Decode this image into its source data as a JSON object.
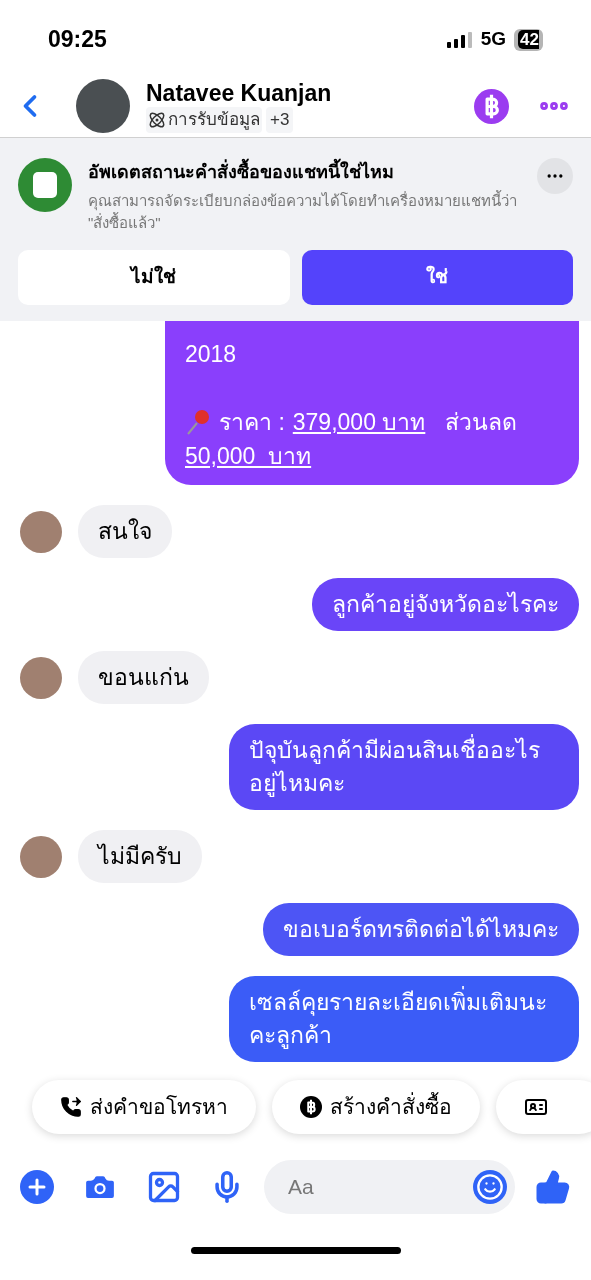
{
  "status_bar": {
    "time": "09:25",
    "network": "5G",
    "battery": "42"
  },
  "header": {
    "name": "Natavee Kuanjan",
    "tag": "การรับข้อมูล",
    "more_tags": "+3"
  },
  "banner": {
    "title": "อัพเดตสถานะคำสั่งซื้อของแชทนี้ใช่ไหม",
    "body": "คุณสามารถจัดระเบียบกล่องข้อความได้โดยทำเครื่องหมายแชทนี้ว่า \"สั่งซื้อแล้ว\"",
    "buttons": [
      {
        "label": "ไม่ใช่",
        "selected": false
      },
      {
        "label": "ใช่",
        "selected": true
      }
    ]
  },
  "messages": [
    {
      "kind": "sent_price",
      "year": "2018",
      "price_label": "ราคา :",
      "price": "379,000 บาท",
      "discount_label": "ส่วนลด",
      "discount": "50,000  บาท"
    },
    {
      "kind": "received",
      "text": "สนใจ"
    },
    {
      "kind": "sent",
      "text": "ลูกค้าอยู่จังหวัดอะไรคะ"
    },
    {
      "kind": "received",
      "text": "ขอนแก่น"
    },
    {
      "kind": "sent",
      "text": "ปัจุบันลูกค้ามีผ่อนสินเชื่ออะไรอยู่ไหมคะ"
    },
    {
      "kind": "received",
      "text": "ไม่มีครับ"
    },
    {
      "kind": "sent",
      "text": "ขอเบอร์ดทรติดต่อได้ไหมคะ"
    },
    {
      "kind": "sent",
      "text": "เซลล์คุยรายละเอียดเพิ่มเติมนะคะลูกค้า"
    }
  ],
  "quick_replies": [
    {
      "kind": "call",
      "label": "ส่งคำขอโทรหา"
    },
    {
      "kind": "order",
      "label": "สร้างคำสั่งซื้อ"
    },
    {
      "kind": "card"
    }
  ],
  "composer": {
    "placeholder": "Aa"
  }
}
